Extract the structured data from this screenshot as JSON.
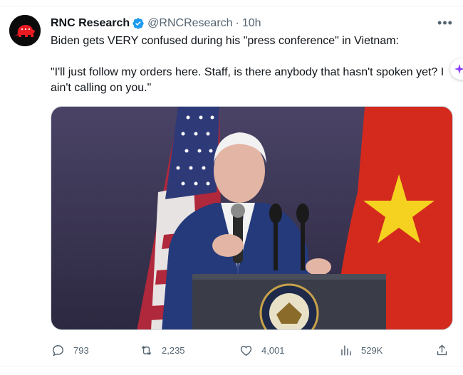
{
  "tweet": {
    "author_name": "RNC Research",
    "handle": "@RNCResearch",
    "separator": "·",
    "time": "10h",
    "text_line1": "Biden gets VERY confused during his \"press conference\" in Vietnam:",
    "text_quote": "\"I'll just follow my orders here. Staff, is there anybody that hasn't spoken yet? I ain't calling on you.\""
  },
  "icons": {
    "avatar": "gop-elephant-logo",
    "verified": "verified-badge-icon",
    "more": "more-icon",
    "grok": "grok-sparkle-icon",
    "reply": "reply-icon",
    "retweet": "retweet-icon",
    "like": "like-icon",
    "views": "views-icon",
    "share": "share-icon"
  },
  "actions": {
    "replies": "793",
    "retweets": "2,235",
    "likes": "4,001",
    "views": "529K"
  },
  "colors": {
    "verified_blue": "#1d9bf0",
    "secondary_text": "#536471",
    "avatar_red": "#e81b23",
    "grok_purple": "#8b3dff"
  }
}
